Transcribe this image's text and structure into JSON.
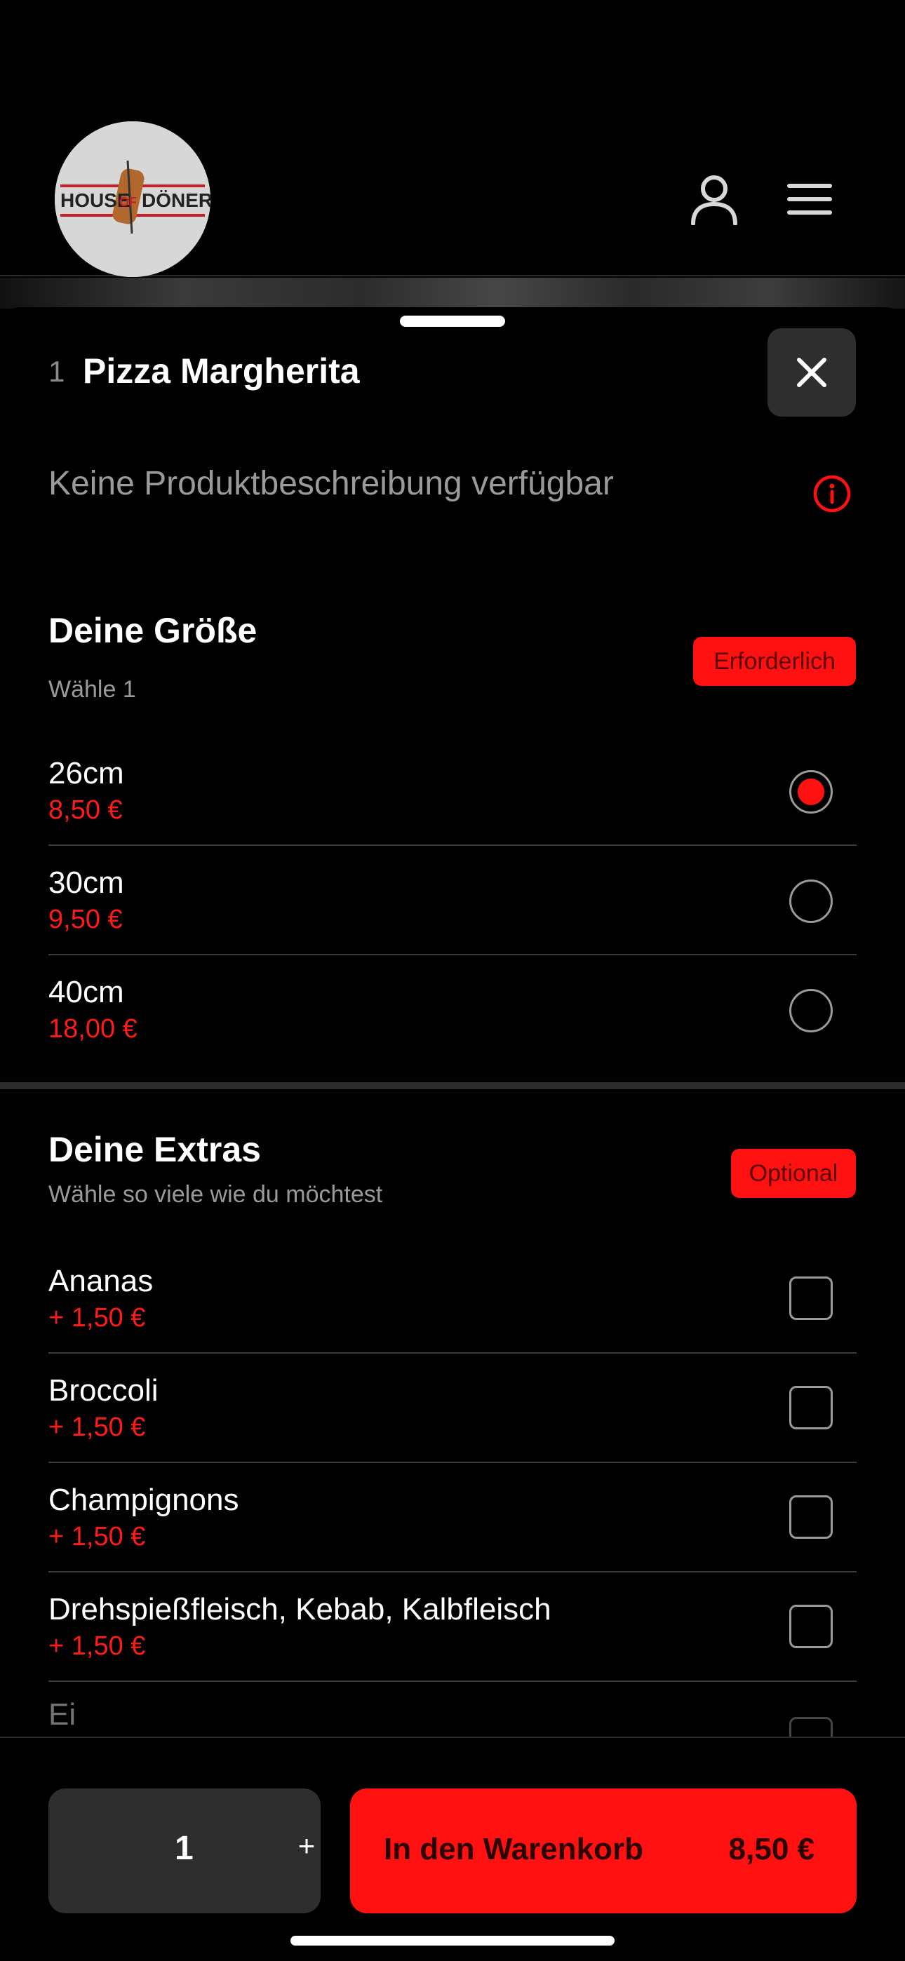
{
  "header": {
    "logo_text_left": "HOUSE",
    "logo_text_mid": "OF",
    "logo_text_right": "DÖNER",
    "icons": [
      "user-icon",
      "menu-icon"
    ]
  },
  "product": {
    "quantity_prefix": "1",
    "title": "Pizza Margherita",
    "description": "Keine Produktbeschreibung verfügbar"
  },
  "size_section": {
    "title": "Deine Größe",
    "subtitle": "Wähle 1",
    "badge": "Erforderlich",
    "options": [
      {
        "name": "26cm",
        "price": "8,50 €",
        "selected": true
      },
      {
        "name": "30cm",
        "price": "9,50 €",
        "selected": false
      },
      {
        "name": "40cm",
        "price": "18,00 €",
        "selected": false
      }
    ]
  },
  "extras_section": {
    "title": "Deine Extras",
    "subtitle": "Wähle so viele wie du möchtest",
    "badge": "Optional",
    "options": [
      {
        "name": "Ananas",
        "price": "+ 1,50 €"
      },
      {
        "name": "Broccoli",
        "price": "+ 1,50 €"
      },
      {
        "name": "Champignons",
        "price": "+ 1,50 €"
      },
      {
        "name": "Drehspießfleisch, Kebab, Kalbfleisch",
        "price": "+ 1,50 €"
      },
      {
        "name": "Ei",
        "price": ""
      }
    ]
  },
  "bottom_bar": {
    "quantity": "1",
    "plus_label": "+",
    "cart_label": "In den Warenkorb",
    "cart_price": "8,50 €"
  },
  "colors": {
    "accent": "#ff1111",
    "background": "#000000",
    "surface": "#2e2e2e"
  }
}
